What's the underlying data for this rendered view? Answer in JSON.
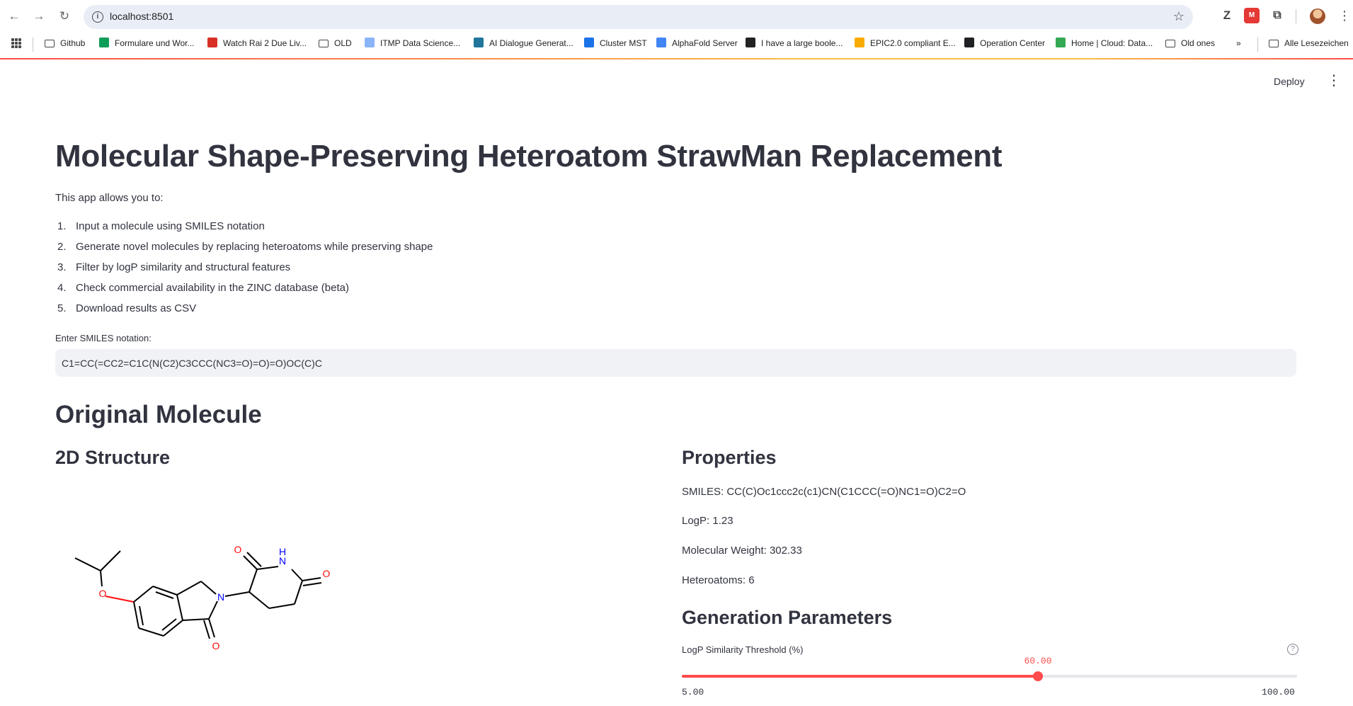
{
  "browser": {
    "url": "localhost:8501",
    "bookmarks": [
      {
        "label": "Github",
        "icon": "folder-icon",
        "color": "#474747"
      },
      {
        "label": "Formulare und Wor...",
        "icon": "sheets-icon",
        "color": "#0f9d58"
      },
      {
        "label": "Watch Rai 2 Due Liv...",
        "icon": "tv-icon",
        "color": "#d93025"
      },
      {
        "label": "OLD",
        "icon": "folder-icon",
        "color": "#474747"
      },
      {
        "label": "ITMP Data Science...",
        "icon": "cloud-icon",
        "color": "#8ab4f8"
      },
      {
        "label": "AI Dialogue Generat...",
        "icon": "wordpress-icon",
        "color": "#21759b"
      },
      {
        "label": "Cluster MST",
        "icon": "docs-icon",
        "color": "#1a73e8"
      },
      {
        "label": "AlphaFold Server",
        "icon": "alphafold-icon",
        "color": "#4285f4"
      },
      {
        "label": "I have a large boole...",
        "icon": "so-icon",
        "color": "#222222"
      },
      {
        "label": "EPIC2.0 compliant E...",
        "icon": "layers-icon",
        "color": "#f9ab00"
      },
      {
        "label": "Operation Center",
        "icon": "g-icon",
        "color": "#202124"
      },
      {
        "label": "Home | Cloud: Data...",
        "icon": "ring-icon",
        "color": "#34a853"
      },
      {
        "label": "Old ones",
        "icon": "folder-icon",
        "color": "#474747"
      }
    ],
    "more_bookmarks": "»",
    "all_bookmarks": "Alle Lesezeichen"
  },
  "app": {
    "deploy_label": "Deploy",
    "menu_glyph": "⋮",
    "title": "Molecular Shape-Preserving Heteroatom StrawMan Replacement",
    "intro": "This app allows you to:",
    "steps": [
      {
        "num": "1.",
        "text": "Input a molecule using SMILES notation"
      },
      {
        "num": "2.",
        "text": "Generate novel molecules by replacing heteroatoms while preserving shape"
      },
      {
        "num": "3.",
        "text": "Filter by logP similarity and structural features"
      },
      {
        "num": "4.",
        "text": "Check commercial availability in the ZINC database (beta)"
      },
      {
        "num": "5.",
        "text": "Download results as CSV"
      }
    ],
    "smiles_label": "Enter SMILES notation:",
    "smiles_value": "C1=CC(=CC2=C1C(N(C2)C3CCC(NC3=O)=O)=O)OC(C)C",
    "original_heading": "Original Molecule",
    "structure_heading": "2D Structure",
    "properties_heading": "Properties",
    "properties": {
      "smiles": "SMILES: CC(C)Oc1ccc2c(c1)CN(C1CCC(=O)NC1=O)C2=O",
      "logp": "LogP: 1.23",
      "mw": "Molecular Weight: 302.33",
      "heteroatoms": "Heteroatoms: 6"
    },
    "generation_heading": "Generation Parameters",
    "slider": {
      "label": "LogP Similarity Threshold (%)",
      "value_label": "60.00",
      "min_label": "5.00",
      "max_label": "100.00",
      "min": 5,
      "max": 100,
      "value": 60,
      "accent": "#ff4b4b"
    },
    "atoms": {
      "O": "O",
      "N": "N",
      "H": "H"
    },
    "colors": {
      "oxygen": "#ff0d0d",
      "nitrogen": "#0000ff",
      "bond": "#000000"
    }
  }
}
